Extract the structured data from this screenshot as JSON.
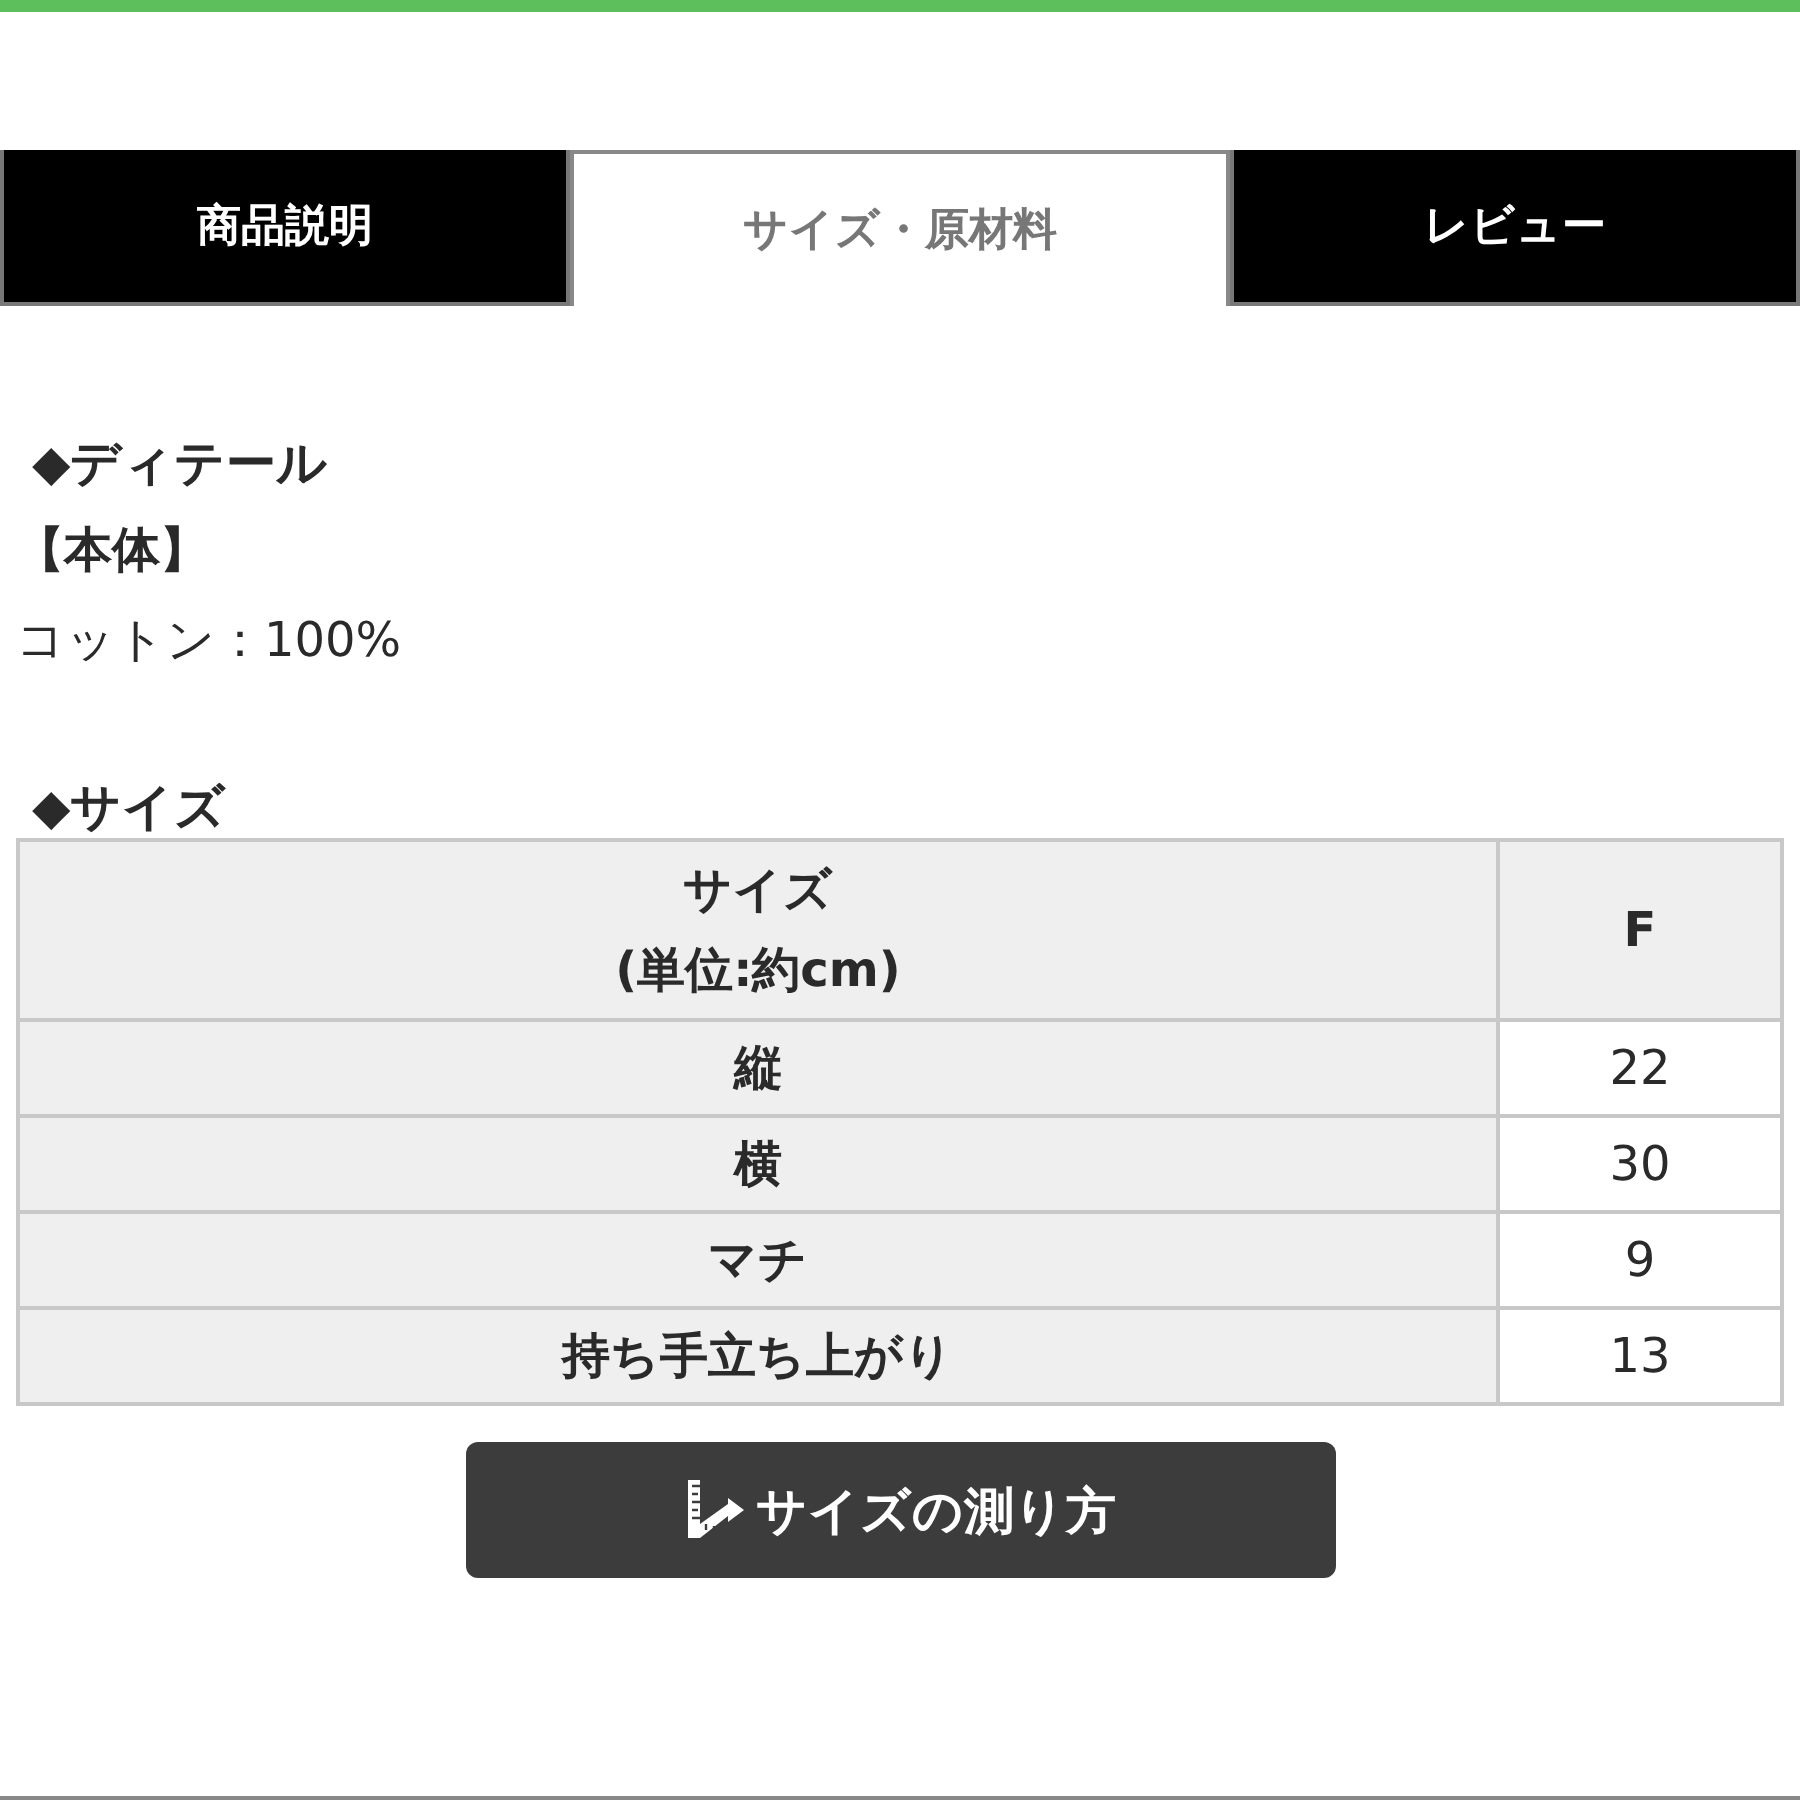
{
  "tabs": [
    {
      "label": "商品説明",
      "selected": false
    },
    {
      "label": "サイズ・原材料",
      "selected": true
    },
    {
      "label": "レビュー",
      "selected": false
    }
  ],
  "detail": {
    "heading": "◆ディテール",
    "part": "【本体】",
    "material": "コットン：100%"
  },
  "size": {
    "heading": "◆サイズ",
    "header": {
      "label_lines": [
        "サイズ",
        "(単位:約cm)"
      ],
      "value": "F"
    },
    "rows": [
      {
        "label": "縦",
        "value": "22"
      },
      {
        "label": "横",
        "value": "30"
      },
      {
        "label": "マチ",
        "value": "9"
      },
      {
        "label": "持ち手立ち上がり",
        "value": "13"
      }
    ]
  },
  "button": {
    "label": "サイズの測り方"
  }
}
